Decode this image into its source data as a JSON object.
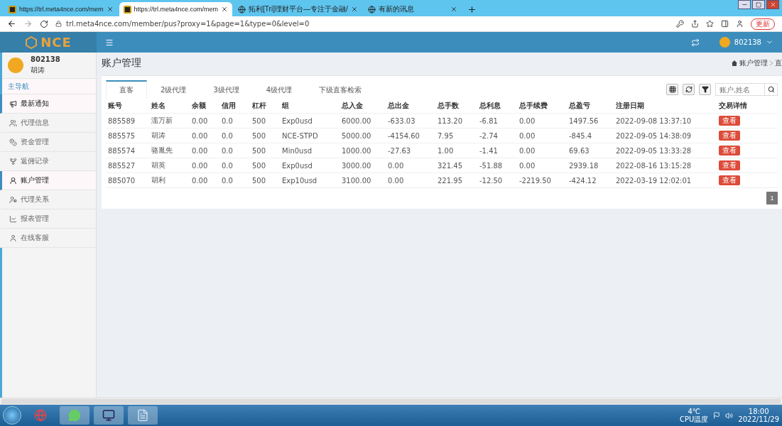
{
  "browser": {
    "tabs": [
      {
        "title": "https://trl.meta4nce.com/mem",
        "selected": false
      },
      {
        "title": "https://trl.meta4nce.com/mem",
        "selected": true
      },
      {
        "title": "拓利[Tri]理财平台—专注于金融/",
        "selected": false
      },
      {
        "title": "有新的讯息",
        "selected": false
      }
    ],
    "url": "trl.meta4nce.com/member/pus?proxy=1&page=1&type=0&level=0",
    "update_button": "更新"
  },
  "header": {
    "logo": "NCE",
    "user": "802138"
  },
  "sidebar": {
    "user_id": "802138",
    "user_name": "胡涛",
    "section": "主导航",
    "items": [
      {
        "label": "最新通知",
        "selected": true
      },
      {
        "label": "代理信息",
        "selected": false
      },
      {
        "label": "资金管理",
        "selected": false
      },
      {
        "label": "返佣记录",
        "selected": false
      },
      {
        "label": "账户管理",
        "selected": true
      },
      {
        "label": "代理关系",
        "selected": false
      },
      {
        "label": "报表管理",
        "selected": false
      },
      {
        "label": "在线客服",
        "selected": false
      }
    ]
  },
  "page": {
    "title": "账户管理",
    "breadcrumb": [
      "账户管理",
      "直"
    ],
    "tabs": [
      {
        "label": "直客",
        "selected": true
      },
      {
        "label": "2级代理",
        "selected": false
      },
      {
        "label": "3级代理",
        "selected": false
      },
      {
        "label": "4级代理",
        "selected": false
      },
      {
        "label": "下级直客检索",
        "selected": false
      }
    ],
    "search": {
      "placeholder": "账户,姓名"
    },
    "table": {
      "columns": [
        "账号",
        "姓名",
        "余额",
        "信用",
        "杠杆",
        "组",
        "总入金",
        "总出金",
        "总手数",
        "总利息",
        "总手续费",
        "总盈亏",
        "注册日期",
        "交易详情"
      ],
      "rows": [
        {
          "cells": [
            "885589",
            "濡万新",
            "0.00",
            "0.0",
            "500",
            "Exp0usd",
            "6000.00",
            "-633.03",
            "113.20",
            "-6.81",
            "0.00",
            "1497.56",
            "2022-09-08 13:37:10"
          ],
          "action": "查看"
        },
        {
          "cells": [
            "885575",
            "胡涛",
            "0.00",
            "0.0",
            "500",
            "NCE-STPD",
            "5000.00",
            "-4154.60",
            "7.95",
            "-2.74",
            "0.00",
            "-845.4",
            "2022-09-05 14:38:09"
          ],
          "action": "查看"
        },
        {
          "cells": [
            "885574",
            "骆胤先",
            "0.00",
            "0.0",
            "500",
            "Min0usd",
            "1000.00",
            "-27.63",
            "1.00",
            "-1.41",
            "0.00",
            "69.63",
            "2022-09-05 13:33:28"
          ],
          "action": "查看"
        },
        {
          "cells": [
            "885527",
            "胡英",
            "0.00",
            "0.0",
            "500",
            "Exp0usd",
            "3000.00",
            "0.00",
            "321.45",
            "-51.88",
            "0.00",
            "2939.18",
            "2022-08-16 13:15:28"
          ],
          "action": "查看"
        },
        {
          "cells": [
            "885070",
            "胡利",
            "0.00",
            "0.0",
            "500",
            "Exp10usd",
            "3100.00",
            "0.00",
            "221.95",
            "-12.50",
            "-2219.50",
            "-424.12",
            "2022-03-19 12:02:01"
          ],
          "action": "查看"
        }
      ]
    },
    "pagination": [
      {
        "label": "1",
        "selected": true
      }
    ]
  },
  "taskbar": {
    "temperature": "4℃",
    "sensor": "CPU温度",
    "time": "18:00",
    "date": "2022/11/29"
  }
}
